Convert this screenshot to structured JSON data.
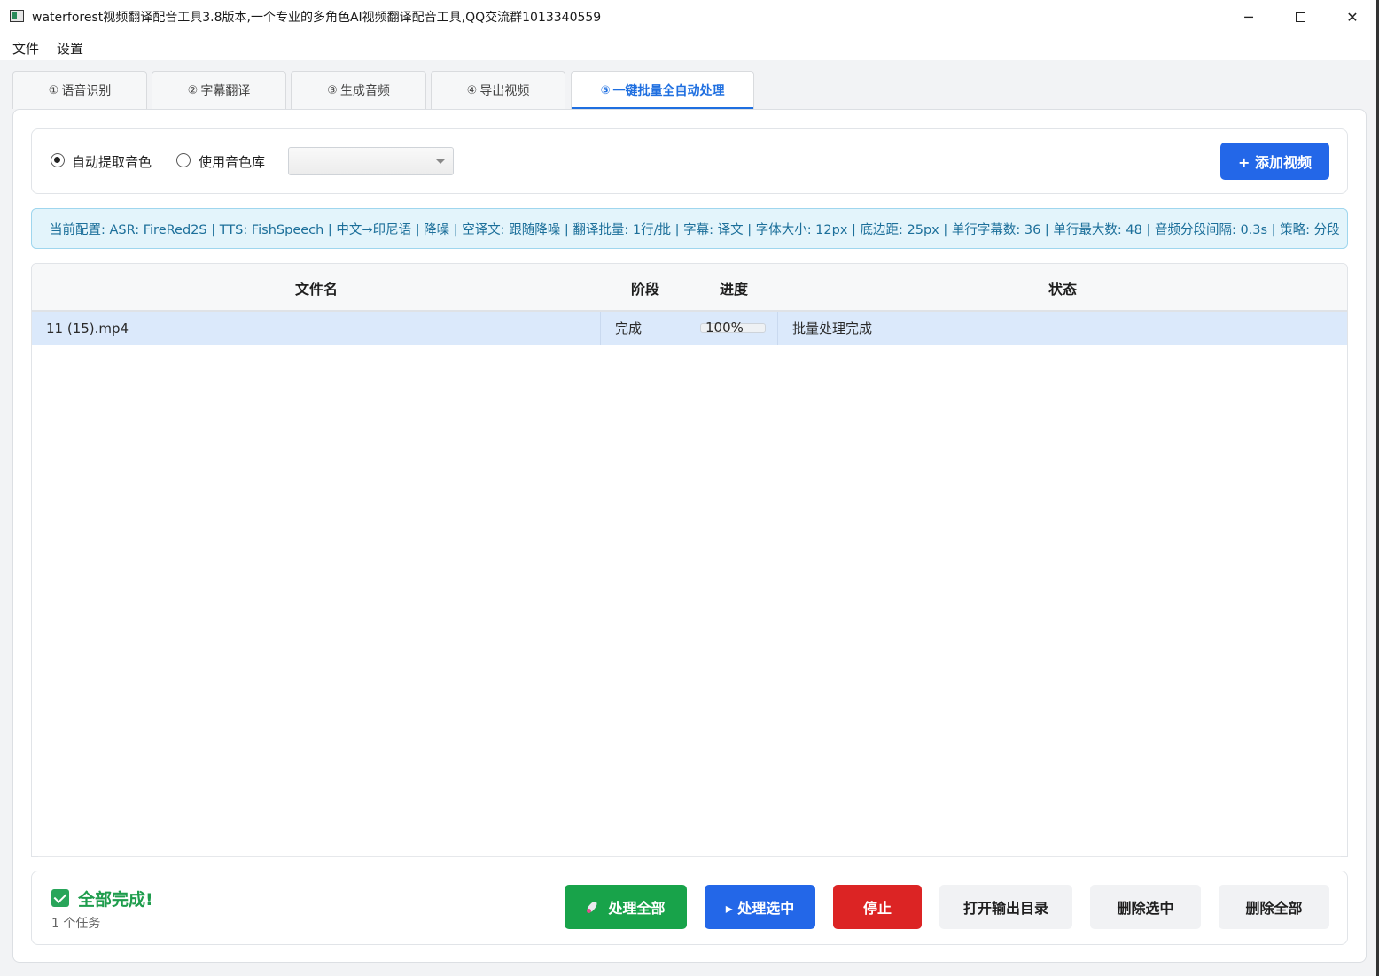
{
  "window": {
    "title": "waterforest视频翻译配音工具3.8版本,一个专业的多角色AI视频翻译配音工具,QQ交流群1013340559",
    "minimize": "─",
    "close": "✕"
  },
  "menu": {
    "file": "文件",
    "settings": "设置"
  },
  "tabs": [
    {
      "num": "①",
      "label": "语音识别"
    },
    {
      "num": "②",
      "label": "字幕翻译"
    },
    {
      "num": "③",
      "label": "生成音频"
    },
    {
      "num": "④",
      "label": "导出视频"
    },
    {
      "num": "⑤",
      "label": "一键批量全自动处理",
      "active": true
    }
  ],
  "options": {
    "auto_extract_label": "自动提取音色",
    "auto_extract_checked": true,
    "voice_library_label": "使用音色库",
    "voice_library_checked": false,
    "voice_select_value": "",
    "add_video_label": "+ 添加视频"
  },
  "info": {
    "config_text": "当前配置: ASR: FireRed2S | TTS: FishSpeech | 中文→印尼语 | 降噪 | 空译文: 跟随降噪 | 翻译批量: 1行/批 | 字幕: 译文 | 字体大小: 12px | 底边距: 25px | 单行字幕数: 36 | 单行最大数: 48 | 音频分段间隔: 0.3s | 策略: 分段"
  },
  "table": {
    "headers": [
      "文件名",
      "阶段",
      "进度",
      "状态"
    ],
    "rows": [
      {
        "filename": "11 (15).mp4",
        "stage": "完成",
        "progress": 100,
        "progress_text": "100%",
        "status": "批量处理完成"
      }
    ]
  },
  "footer": {
    "done_text": "全部完成!",
    "task_count": "1 个任务",
    "process_all": "处理全部",
    "process_selected": "▸ 处理选中",
    "stop": "停止",
    "open_output": "打开输出目录",
    "delete_selected": "删除选中",
    "delete_all": "删除全部"
  },
  "colors": {
    "accent": "#2367e8",
    "success": "#18a34a",
    "danger": "#dc2424",
    "info_bg": "#e3f4fb",
    "selected_row": "#dbe9fb"
  }
}
